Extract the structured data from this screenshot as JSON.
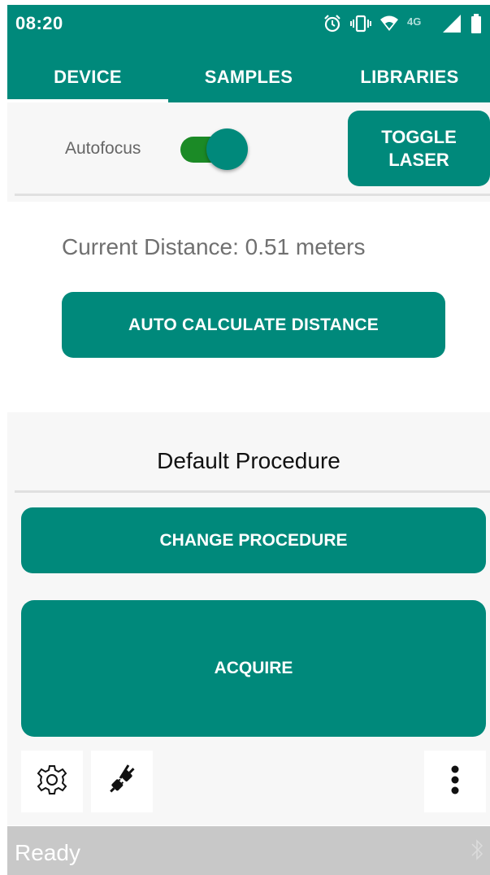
{
  "status_bar": {
    "time": "08:20",
    "network_label": "4G",
    "icons": [
      "alarm-icon",
      "vibrate-icon",
      "wifi-icon",
      "network-4g-icon",
      "signal-icon",
      "battery-icon"
    ]
  },
  "tabs": [
    {
      "label": "DEVICE",
      "active": true
    },
    {
      "label": "SAMPLES",
      "active": false
    },
    {
      "label": "LIBRARIES",
      "active": false
    }
  ],
  "device": {
    "autofocus_label": "Autofocus",
    "autofocus_enabled": true,
    "toggle_laser_label": "TOGGLE\nLASER",
    "current_distance": "Current Distance: 0.51 meters",
    "auto_calculate_label": "AUTO CALCULATE DISTANCE"
  },
  "procedure": {
    "name": "Default Procedure",
    "change_label": "CHANGE PROCEDURE",
    "acquire_label": "ACQUIRE"
  },
  "toolbar": {
    "icons": [
      "gear-icon",
      "plug-disconnected-icon",
      "more-vert-icon"
    ]
  },
  "footer": {
    "status": "Ready",
    "icon": "bluetooth-icon"
  },
  "colors": {
    "primary": "#00897b",
    "switch_track": "#1b8a26",
    "panel_bg": "#f7f7f7",
    "footer_bg": "#c8c8c8"
  }
}
